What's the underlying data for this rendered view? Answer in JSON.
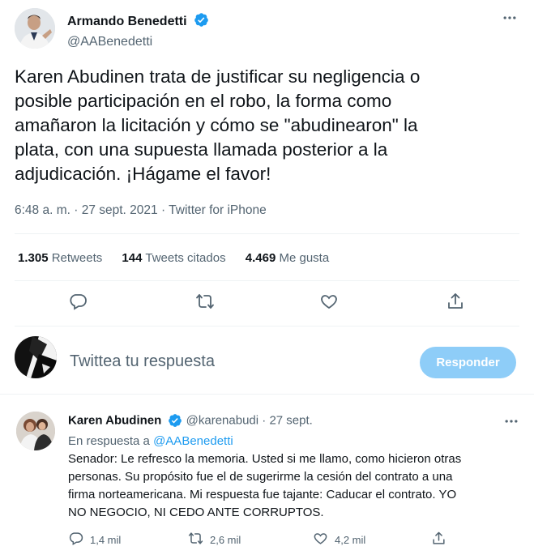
{
  "tweet": {
    "author_name": "Armando Benedetti",
    "author_handle": "@AABenedetti",
    "text_lines": [
      "Karen Abudinen trata de justificar su negligencia o",
      "posible participación en el robo, la forma como",
      "amañaron la licitación y cómo se \"abudinearon\" la",
      "plata, con una supuesta llamada posterior a la",
      "adjudicación. ¡Hágame el favor!"
    ],
    "meta": "6:48 a. m. · 27 sept. 2021 · Twitter for iPhone",
    "stats": {
      "retweets_count": "1.305",
      "retweets_label": "Retweets",
      "quotes_count": "144",
      "quotes_label": "Tweets citados",
      "likes_count": "4.469",
      "likes_label": "Me gusta"
    }
  },
  "composer": {
    "placeholder": "Twittea tu respuesta",
    "button_label": "Responder"
  },
  "reply": {
    "author_name": "Karen Abudinen",
    "author_handle": "@karenabudi",
    "dot": "·",
    "date": "27 sept.",
    "replying_prefix": "En respuesta a",
    "replying_handle": "@AABenedetti",
    "text_lines": [
      "Senador: Le refresco la memoria. Usted si me llamo, como hicieron otras",
      "personas. Su propósito fue el de sugerirme la cesión del contrato a una",
      "firma norteamericana. Mi respuesta fue tajante: Caducar el contrato. YO",
      "NO NEGOCIO, NI CEDO ANTE CORRUPTOS."
    ],
    "replies_count": "1,4 mil",
    "retweets_count": "2,6 mil",
    "likes_count": "4,2 mil"
  },
  "colors": {
    "accent": "#1d9bf0",
    "muted": "#536471",
    "button_disabled": "#8ecdf8",
    "divider": "#eff3f4"
  },
  "icons": [
    "verified-icon",
    "more-icon",
    "reply-icon",
    "retweet-icon",
    "like-icon",
    "share-icon"
  ]
}
